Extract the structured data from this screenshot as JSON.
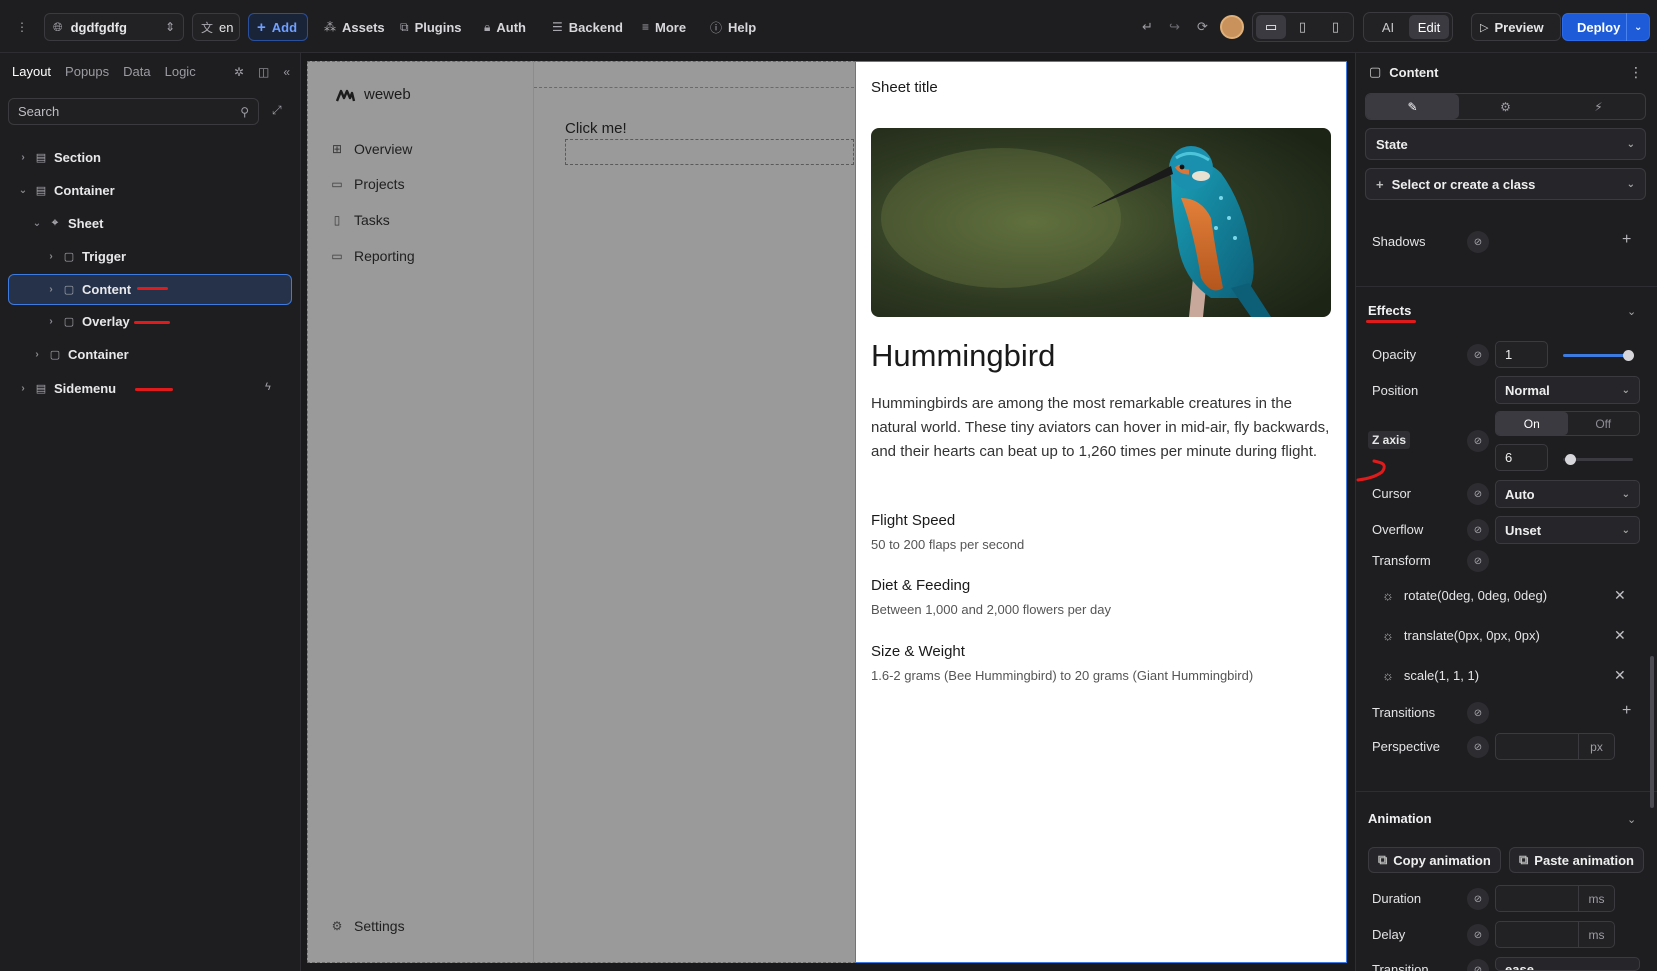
{
  "topbar": {
    "project_name": "dgdfgdfg",
    "lang": "en",
    "add": "Add",
    "assets": "Assets",
    "plugins": "Plugins",
    "auth": "Auth",
    "backend": "Backend",
    "more": "More",
    "help": "Help",
    "ai": "AI",
    "edit": "Edit",
    "preview": "Preview",
    "deploy": "Deploy"
  },
  "left_panel": {
    "tabs": [
      "Layout",
      "Popups",
      "Data",
      "Logic"
    ],
    "search_placeholder": "Search",
    "tree": [
      {
        "label": "Section"
      },
      {
        "label": "Container"
      },
      {
        "label": "Sheet"
      },
      {
        "label": "Trigger"
      },
      {
        "label": "Content"
      },
      {
        "label": "Overlay"
      },
      {
        "label": "Container"
      },
      {
        "label": "Sidemenu"
      }
    ]
  },
  "canvas": {
    "logo": "weweb",
    "nav": [
      "Overview",
      "Projects",
      "Tasks",
      "Reporting"
    ],
    "settings": "Settings",
    "button_text": "Click me!",
    "sheet": {
      "title": "Sheet title",
      "heading": "Hummingbird",
      "paragraph": "Hummingbirds are among the most remarkable creatures in the natural world. These tiny aviators can hover in mid-air, fly backwards, and their hearts can beat up to 1,260 times per minute during flight.",
      "facts": [
        {
          "title": "Flight Speed",
          "desc": "50 to 200 flaps per second"
        },
        {
          "title": "Diet & Feeding",
          "desc": "Between 1,000 and 2,000 flowers per day"
        },
        {
          "title": "Size & Weight",
          "desc": "1.6-2 grams (Bee Hummingbird) to 20 grams (Giant Hummingbird)"
        }
      ]
    }
  },
  "right_panel": {
    "title": "Content",
    "state": "State",
    "class_placeholder": "Select or create a class",
    "shadows": "Shadows",
    "effects": "Effects",
    "opacity_label": "Opacity",
    "opacity_value": "1",
    "position_label": "Position",
    "position_value": "Normal",
    "zaxis_label": "Z axis",
    "zaxis_on": "On",
    "zaxis_off": "Off",
    "zaxis_value": "6",
    "cursor_label": "Cursor",
    "cursor_value": "Auto",
    "overflow_label": "Overflow",
    "overflow_value": "Unset",
    "transform_label": "Transform",
    "transforms": [
      "rotate(0deg, 0deg, 0deg)",
      "translate(0px, 0px, 0px)",
      "scale(1, 1, 1)"
    ],
    "transitions_label": "Transitions",
    "perspective_label": "Perspective",
    "perspective_unit": "px",
    "animation": "Animation",
    "copy_animation": "Copy animation",
    "paste_animation": "Paste animation",
    "duration_label": "Duration",
    "delay_label": "Delay",
    "ms": "ms",
    "transition_label": "Transition",
    "transition_value": "ease"
  },
  "colors": {
    "accent": "#3d7be0",
    "deploy": "#1d5bd8",
    "annotation": "#e01b1b"
  }
}
